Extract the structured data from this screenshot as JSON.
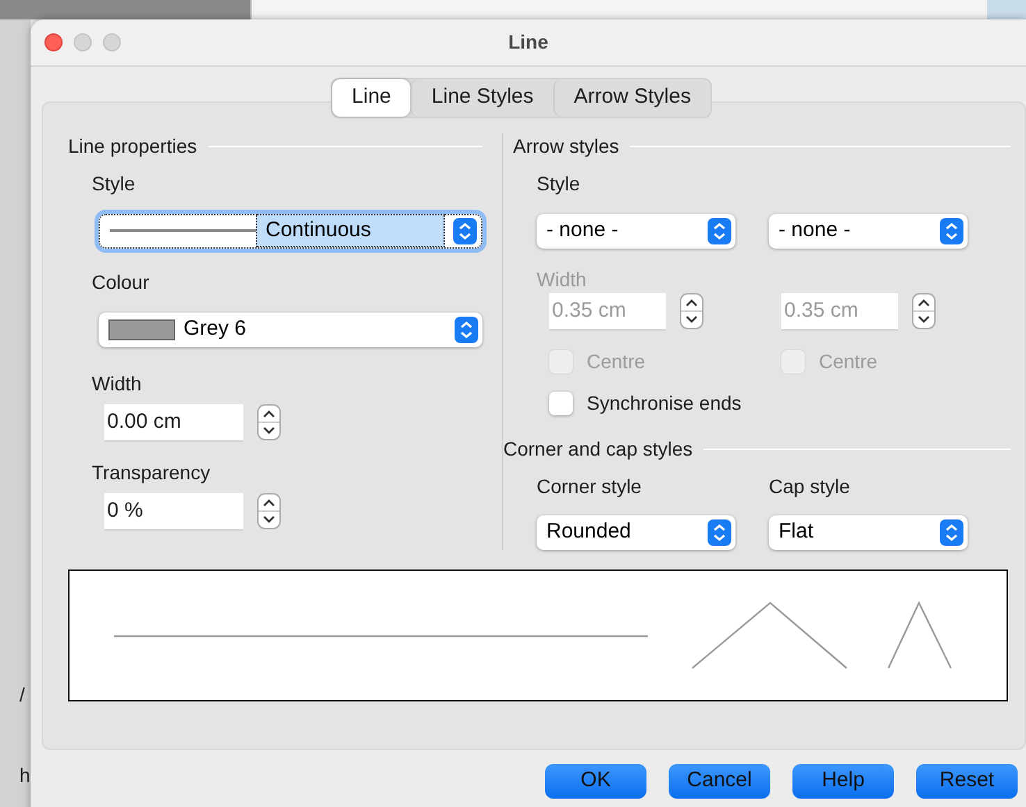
{
  "window": {
    "title": "Line"
  },
  "tabs": [
    {
      "label": "Line",
      "selected": true
    },
    {
      "label": "Line Styles",
      "selected": false
    },
    {
      "label": "Arrow Styles",
      "selected": false
    }
  ],
  "line_properties": {
    "heading": "Line properties",
    "style_label": "Style",
    "style_value": "Continuous",
    "colour_label": "Colour",
    "colour_value": "Grey 6",
    "width_label": "Width",
    "width_value": "0.00 cm",
    "transparency_label": "Transparency",
    "transparency_value": "0 %"
  },
  "arrow_styles": {
    "heading": "Arrow styles",
    "style_label": "Style",
    "start_style": "- none -",
    "end_style": "- none -",
    "width_label": "Width",
    "width_disabled": true,
    "start_width": "0.35 cm",
    "end_width": "0.35 cm",
    "centre_checks": [
      {
        "label": "Centre",
        "checked": false,
        "disabled": true
      },
      {
        "label": "Centre",
        "checked": false,
        "disabled": true
      }
    ],
    "synchronise": {
      "label": "Synchronise ends",
      "checked": false,
      "disabled": false
    }
  },
  "corner_cap": {
    "heading": "Corner and cap styles",
    "corner_label": "Corner style",
    "corner_value": "Rounded",
    "cap_label": "Cap style",
    "cap_value": "Flat"
  },
  "buttons": [
    "OK",
    "Cancel",
    "Help",
    "Reset"
  ],
  "background_fragments": [
    "/",
    "h"
  ]
}
